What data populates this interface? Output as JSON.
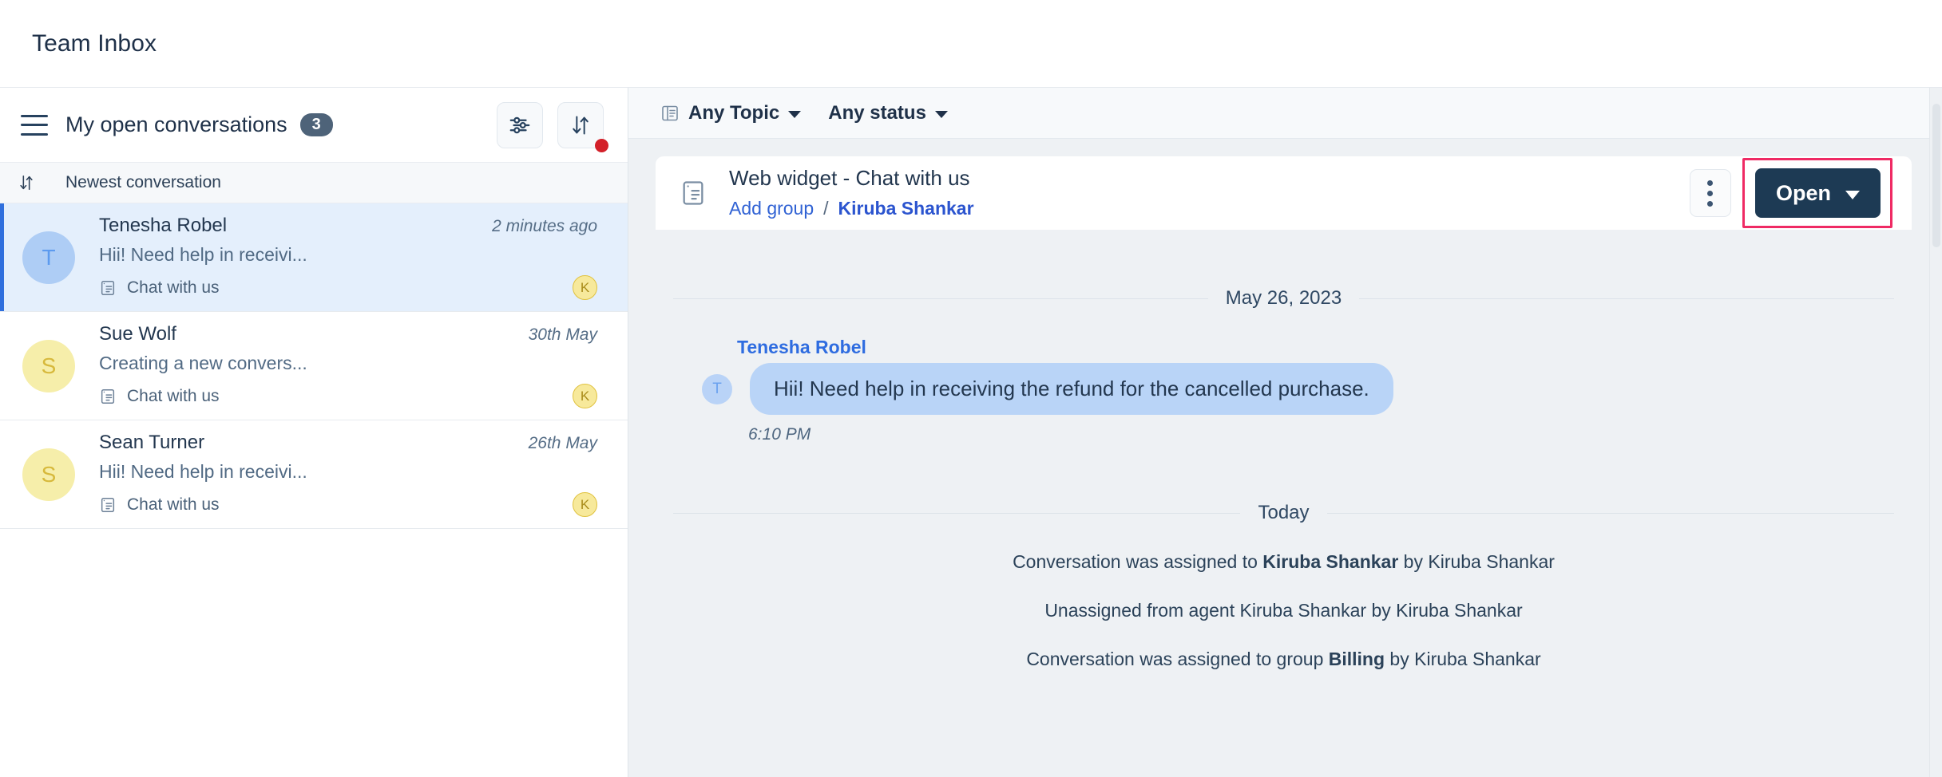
{
  "app": {
    "title": "Team Inbox"
  },
  "sidebar": {
    "menu_icon": "hamburger-icon",
    "title": "My open conversations",
    "count": "3",
    "filter_icon": "sliders-icon",
    "sort_icon": "sort-arrows-icon",
    "sort_row": {
      "icon": "sort-arrows-icon",
      "label": "Newest conversation"
    },
    "conversations": [
      {
        "avatar_initial": "T",
        "avatar_color": "#aecdf5",
        "name": "Tenesha Robel",
        "time": "2 minutes ago",
        "preview": "Hii! Need help in receivi...",
        "channel_icon": "web-widget-icon",
        "channel": "Chat with us",
        "agent_initial": "K",
        "selected": true
      },
      {
        "avatar_initial": "S",
        "avatar_color": "#f6eeaa",
        "name": "Sue Wolf",
        "time": "30th May",
        "preview": "Creating a new convers...",
        "channel_icon": "web-widget-icon",
        "channel": "Chat with us",
        "agent_initial": "K",
        "selected": false
      },
      {
        "avatar_initial": "S",
        "avatar_color": "#f6eeaa",
        "name": "Sean Turner",
        "time": "26th May",
        "preview": "Hii! Need help in receivi...",
        "channel_icon": "web-widget-icon",
        "channel": "Chat with us",
        "agent_initial": "K",
        "selected": false
      }
    ]
  },
  "main": {
    "filters": {
      "topic_icon": "topic-icon",
      "topic_label": "Any Topic",
      "status_label": "Any status"
    },
    "conversation": {
      "channel_icon": "web-widget-icon",
      "subject": "Web widget - Chat with us",
      "group_label": "Add group",
      "breadcrumb_separator": "/",
      "assignee": "Kiruba Shankar",
      "kebab_icon": "more-vertical-icon",
      "status_button_label": "Open",
      "status_button_chevron": "chevron-down-icon",
      "status_button_color": "#1d3a54",
      "highlight_color": "#ef2a64"
    },
    "thread": {
      "day_separator_1": "May 26, 2023",
      "message": {
        "avatar_initial": "T",
        "sender": "Tenesha Robel",
        "text": "Hii! Need help in receiving the refund for the cancelled purchase.",
        "time": "6:10 PM"
      },
      "day_separator_2": "Today",
      "system_messages": [
        {
          "pre": "Conversation was assigned to ",
          "strong": "Kiruba Shankar",
          "post": " by Kiruba Shankar"
        },
        {
          "pre": "Unassigned from agent Kiruba Shankar by Kiruba Shankar",
          "strong": "",
          "post": ""
        },
        {
          "pre": "Conversation was assigned to group ",
          "strong": "Billing",
          "post": " by Kiruba Shankar"
        }
      ]
    }
  }
}
